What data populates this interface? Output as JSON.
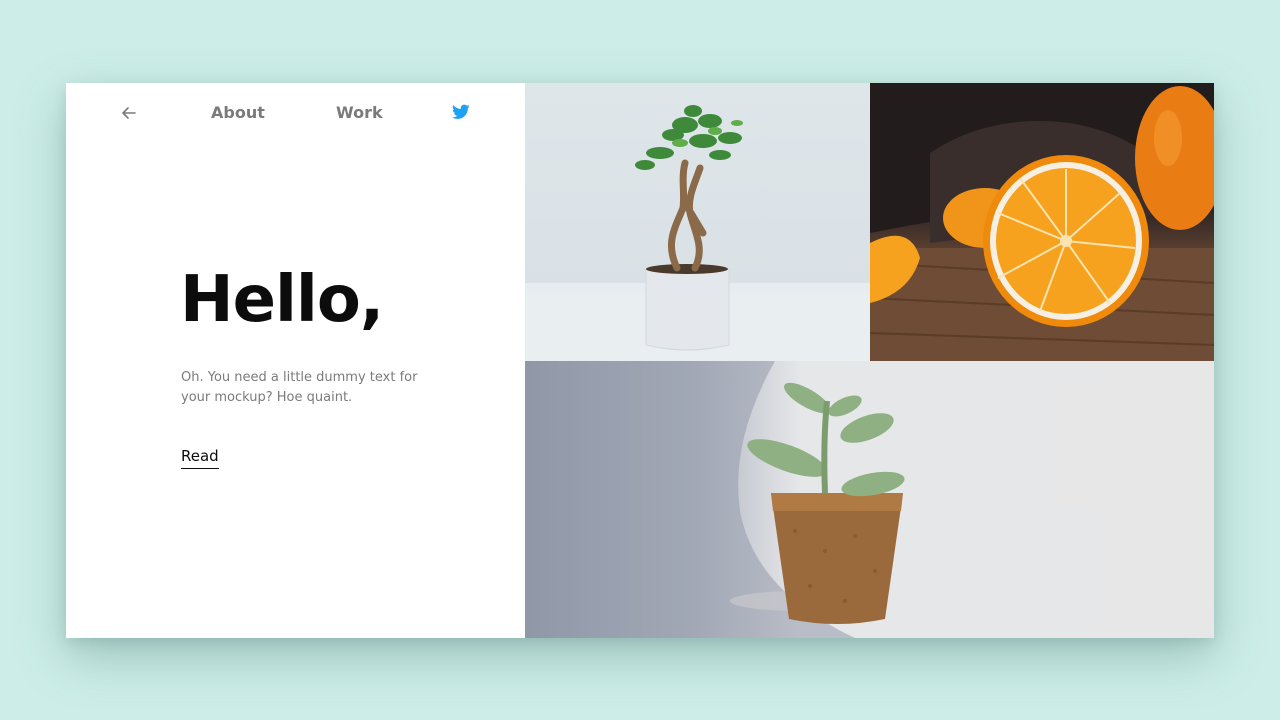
{
  "nav": {
    "back_icon": "arrow-left-icon",
    "about_label": "About",
    "work_label": "Work",
    "twitter_icon": "twitter-icon",
    "twitter_color": "#1da1f2"
  },
  "hero": {
    "title": "Hello,",
    "body": "Oh. You need a little dummy text for your mockup? Hoe quaint.",
    "read_label": "Read"
  },
  "colors": {
    "page_background": "#cdeee8",
    "card_background": "#ffffff",
    "title_color": "#0c0c0c",
    "muted_text": "#7b7b7b"
  }
}
